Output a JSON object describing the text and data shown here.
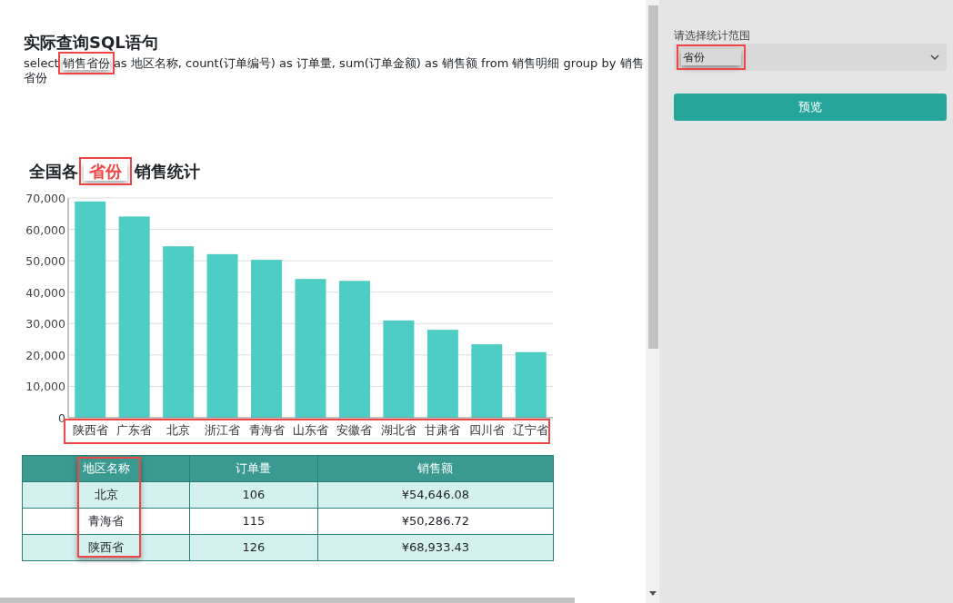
{
  "sql_section": {
    "title": "实际查询SQL语句",
    "parts": [
      {
        "text": "select ",
        "highlighted": false
      },
      {
        "text": "销售省份",
        "highlighted": true
      },
      {
        "text": " as 地区名称, count(订单编号) as 订单量, sum(订单金额) as 销售额 from 销售明细 group by 销售省份",
        "highlighted": false
      }
    ]
  },
  "chart_section": {
    "title_parts": [
      {
        "text": "全国各 ",
        "highlighted": false
      },
      {
        "text": "省份",
        "highlighted": true
      },
      {
        "text": "销售统计",
        "highlighted": false
      }
    ],
    "chart_data": {
      "type": "bar",
      "categories": [
        "陕西省",
        "广东省",
        "北京",
        "浙江省",
        "青海省",
        "山东省",
        "安徽省",
        "湖北省",
        "甘肃省",
        "四川省",
        "辽宁省"
      ],
      "series": [
        {
          "color": "#4ecdc4",
          "values": [
            68900,
            64100,
            54600,
            52100,
            50300,
            44200,
            43600,
            31000,
            28000,
            23400,
            20900
          ]
        }
      ],
      "grid": true,
      "ylim": [
        0,
        70000
      ],
      "yticks": [
        {
          "value": 0,
          "label": "0"
        },
        {
          "value": 10000,
          "label": "10,000"
        },
        {
          "value": 20000,
          "label": "20,000"
        },
        {
          "value": 30000,
          "label": "30,000"
        },
        {
          "value": 40000,
          "label": "40,000"
        },
        {
          "value": 50000,
          "label": "50,000"
        },
        {
          "value": 60000,
          "label": "60,000"
        },
        {
          "value": 70000,
          "label": "70,000"
        }
      ]
    },
    "categories_highlighted": true
  },
  "table": {
    "columns": [
      {
        "label": "地区名称",
        "highlighted": true
      },
      {
        "label": "订单量",
        "highlighted": false
      },
      {
        "label": "销售额",
        "highlighted": false
      }
    ],
    "rows": [
      [
        "北京",
        "106",
        "¥54,646.08"
      ],
      [
        "青海省",
        "115",
        "¥50,286.72"
      ],
      [
        "陕西省",
        "126",
        "¥68,933.43"
      ]
    ]
  },
  "sidebar": {
    "label": "请选择统计范围",
    "select": {
      "value": "省份",
      "highlighted": true
    },
    "button": "预览"
  }
}
